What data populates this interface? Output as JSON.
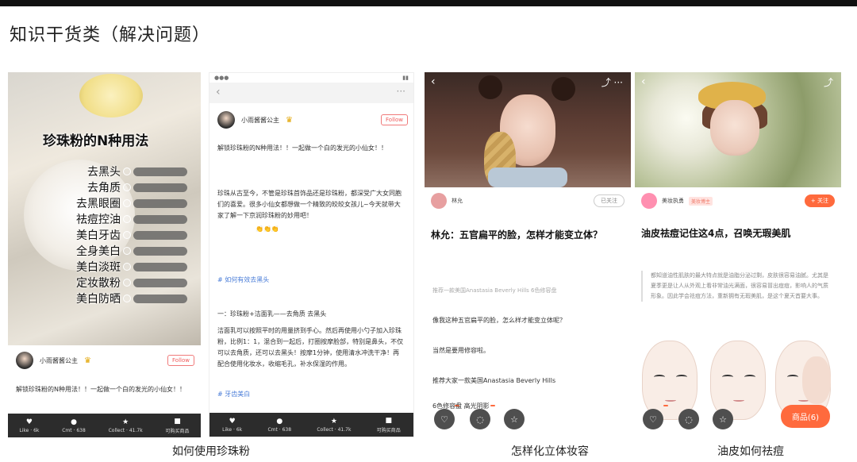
{
  "page_title": "知识干货类（解决问题）",
  "captions": [
    "如何使用珍珠粉",
    "怎样化立体妆容",
    "油皮如何祛痘"
  ],
  "panel1": {
    "heading": "珍珠粉的N种用法",
    "uses": [
      "去黑头",
      "去角质",
      "去黑眼圈",
      "祛痘控油",
      "美白牙齿",
      "全身美白",
      "美白淡斑",
      "定妆散粉",
      "美白防晒"
    ],
    "author": "小雨酱酱公主",
    "follow": "Follow",
    "desc": "解锁珍珠粉的N种用法！！一起做一个白的发光的小仙女！！",
    "bottom_bar": [
      {
        "icon": "♥",
        "label": "Like · 6k",
        "name": "like-icon"
      },
      {
        "icon": "●",
        "label": "Cmt · 638",
        "name": "comment-icon"
      },
      {
        "icon": "★",
        "label": "Collect · 41.7k",
        "name": "collect-icon"
      },
      {
        "icon": "■",
        "label": "可购买商品",
        "name": "shop-icon"
      }
    ]
  },
  "panel2": {
    "author": "小雨酱酱公主",
    "follow": "Follow",
    "intro": "解锁珍珠粉的N种用法！！一起做一个白的发光的小仙女！！",
    "para1": "珍珠从古至今，不管是珍珠首饰品还是珍珠粉，都深受广大女同胞们的喜爱。很多小仙女都想做一个精致的皎皎女孩儿~今天就带大家了解一下京润珍珠粉的妙用吧！",
    "emoji1": "👏👏👏",
    "tag1": "# 如何有效去黑头",
    "section": "一：珍珠粉+洁面乳——去角质 去黑头",
    "para2": "洁面乳可以按照平时的用量挤到手心。然后再使用小勺子加入珍珠粉，比例1：1，混合到一起后，打圈按摩脸部，特别是鼻头，不仅可以去角质，还可以去黑头！按摩1分钟，使用清水冲洗干净！再配合使用化妆水，收缩毛孔，补水保湿的作用。",
    "tag2": "# 牙齿美白",
    "bottom_bar": [
      {
        "icon": "♥",
        "label": "Like · 6k",
        "name": "like-icon"
      },
      {
        "icon": "●",
        "label": "Cmt · 638",
        "name": "comment-icon"
      },
      {
        "icon": "★",
        "label": "Collect · 41.7k",
        "name": "collect-icon"
      },
      {
        "icon": "■",
        "label": "可购买商品",
        "name": "shop-icon"
      }
    ]
  },
  "panel3": {
    "author": "林允",
    "follow": "已关注",
    "title": "林允：五官扁平的脸，怎样才能变立体？",
    "lines": [
      "推荐一款美国Anastasia Beverly Hills 6色修容盘",
      "像我这种五官扁平的脸，怎么样才能变立体呢？",
      "当然是要用修容啦。",
      "推荐大家一款美国Anastasia Beverly Hills",
      "6色修容盘 高光阴影"
    ]
  },
  "panel4": {
    "author": "美妆执勇",
    "badge": "美妆博主",
    "follow": "+ 关注",
    "title": "油皮祛痘记住这4点，召唤无瑕美肌",
    "quote": "都知道油性肌肤的最大特点就是油脂分泌过剩，皮肤很容易油腻。尤其是夏季更是让人从外观上看非常油光满面，很容易冒出痘痘，影响人的气质形象。因此学会祛痘方法，重新拥有无瑕美肌，是这个夏天首要大事。",
    "buy": "商品(6)"
  }
}
